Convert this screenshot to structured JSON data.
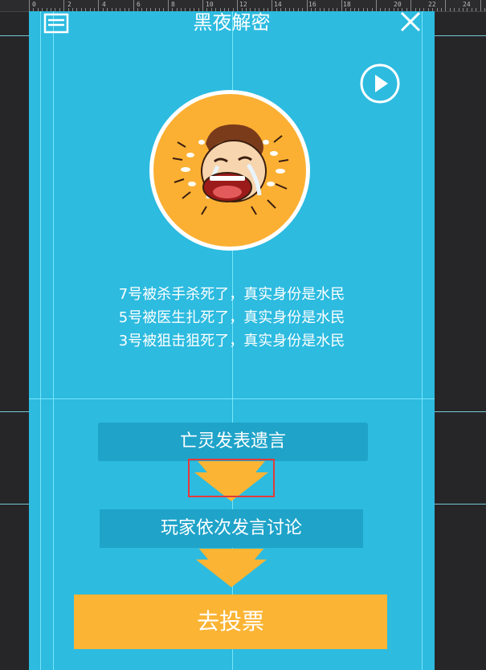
{
  "header": {
    "title": "黑夜解密",
    "menu_icon": "menu-icon",
    "close_icon": "close-icon"
  },
  "ruler": {
    "labels": [
      "0",
      "2",
      "4",
      "6",
      "8",
      "10",
      "12",
      "14",
      "16",
      "18",
      "20",
      "22",
      "24"
    ]
  },
  "media": {
    "play_icon": "play-icon",
    "avatar_icon": "crying-face-icon"
  },
  "deaths": [
    "7号被杀手杀死了，真实身份是水民",
    "5号被医生扎死了，真实身份是水民",
    "3号被狙击狙死了，真实身份是水民"
  ],
  "flow": {
    "step1": "亡灵发表遗言",
    "step2": "玩家依次发言讨论",
    "arrow_icon": "down-arrow-icon"
  },
  "actions": {
    "vote": "去投票"
  },
  "colors": {
    "background": "#2dbbe0",
    "box": "#1fa3c9",
    "accent": "#fbb434",
    "text": "#ffffff"
  }
}
